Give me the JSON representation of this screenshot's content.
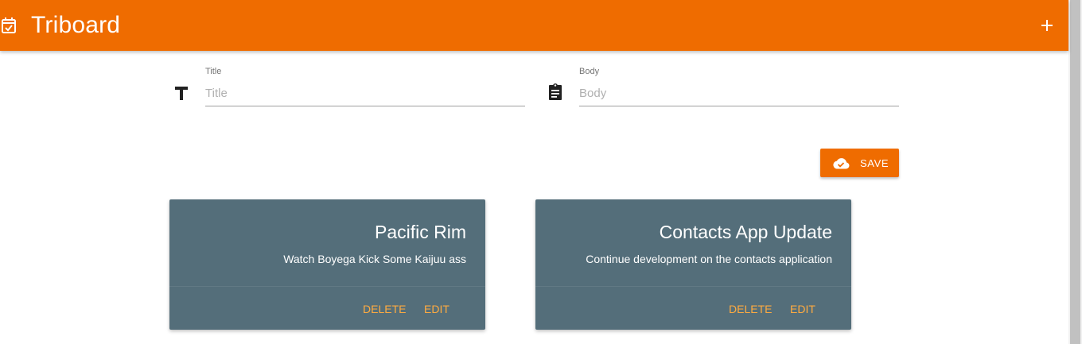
{
  "header": {
    "title": "Triboard",
    "logo_icon": "event-available-icon",
    "add_icon": "plus-icon",
    "color": "#ef6c00"
  },
  "form": {
    "title_field": {
      "label": "Title",
      "placeholder": "Title",
      "value": "",
      "icon": "text-t-icon"
    },
    "body_field": {
      "label": "Body",
      "placeholder": "Body",
      "value": "",
      "icon": "clipboard-icon"
    },
    "save_button": {
      "label": "SAVE",
      "icon": "cloud-done-icon"
    }
  },
  "cards": [
    {
      "title": "Pacific Rim",
      "body": "Watch Boyega Kick Some Kaijuu ass",
      "delete_label": "DELETE",
      "edit_label": "EDIT"
    },
    {
      "title": "Contacts App Update",
      "body": "Continue development on the contacts application",
      "delete_label": "DELETE",
      "edit_label": "EDIT"
    }
  ],
  "colors": {
    "accent": "#ef6c00",
    "card_bg": "#546e7a",
    "card_action": "#ffab40"
  }
}
